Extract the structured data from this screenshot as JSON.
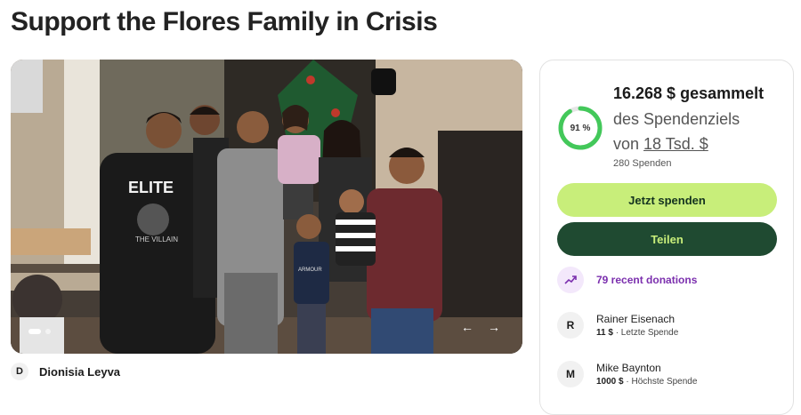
{
  "campaign": {
    "title": "Support the Flores Family in Crisis",
    "organizer_initial": "D",
    "organizer_name": "Dionisia Leyva"
  },
  "gallery": {
    "slide_count": 2,
    "active_slide": 1,
    "prev_icon": "arrow-left-icon",
    "next_icon": "arrow-right-icon",
    "shirt_text": "ELITE",
    "shirt_subtext": "THE VILLAIN",
    "small_shirt_text": "ARMOUR"
  },
  "progress": {
    "percent": 91,
    "percent_label": "91 %",
    "raised": "16.268 $ gesammelt",
    "goal_prefix": "des Spendenziels",
    "goal_von": "von",
    "goal_amount": "18 Tsd. $",
    "donation_count": "280 Spenden"
  },
  "buttons": {
    "donate": "Jetzt spenden",
    "share": "Teilen"
  },
  "recent": {
    "label": "79 recent donations",
    "icon": "trending-up-icon"
  },
  "donors": [
    {
      "initial": "R",
      "name": "Rainer Eisenach",
      "amount": "11 $",
      "note": " · Letzte Spende"
    },
    {
      "initial": "M",
      "name": "Mike Baynton",
      "amount": "1000 $",
      "note": " · Höchste Spende"
    }
  ],
  "colors": {
    "ring": "#43c85a",
    "donate_bg": "#c8ee7a",
    "share_bg": "#1f4a31",
    "recent_text": "#7b2fae"
  }
}
